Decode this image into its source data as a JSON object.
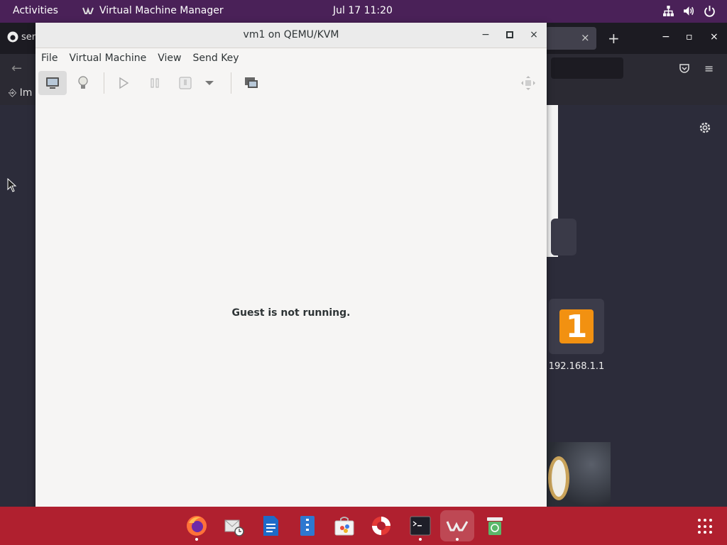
{
  "topbar": {
    "activities": "Activities",
    "app_name": "Virtual Machine Manager",
    "clock": "Jul 17  11:20",
    "tray_icons": [
      "network-icon",
      "volume-icon",
      "power-icon"
    ]
  },
  "browser": {
    "tab_partial": "ser",
    "bookmark_partial": "Im",
    "tab_close": "×",
    "new_tab": "+",
    "window_controls": [
      "−",
      "▫",
      "×"
    ],
    "back": "←",
    "menu": "≡"
  },
  "desktop": {
    "icon_glyph": "1",
    "icon_label": "192.168.1.1"
  },
  "vm_window": {
    "title": "vm1 on QEMU/KVM",
    "controls": {
      "minimize": "−",
      "maximize": "□",
      "close": "×"
    },
    "menu": [
      "File",
      "Virtual Machine",
      "View",
      "Send Key"
    ],
    "toolbar": [
      "console-icon",
      "details-lightbulb-icon",
      "run-icon",
      "pause-icon",
      "shutdown-icon",
      "shutdown-dropdown-icon",
      "screenshot-icon",
      "fullscreen-icon"
    ],
    "message": "Guest is not running."
  },
  "dock": {
    "apps": [
      "firefox-icon",
      "mail-clock-icon",
      "writer-icon",
      "file-manager-icon",
      "software-store-icon",
      "help-lifebuoy-icon",
      "terminal-icon",
      "virt-manager-icon",
      "trash-icon"
    ],
    "accent": "#b0202f"
  },
  "colors": {
    "topbar": "#4a2158",
    "desktop": "#2c2c3a",
    "window_bg": "#f6f5f4"
  }
}
